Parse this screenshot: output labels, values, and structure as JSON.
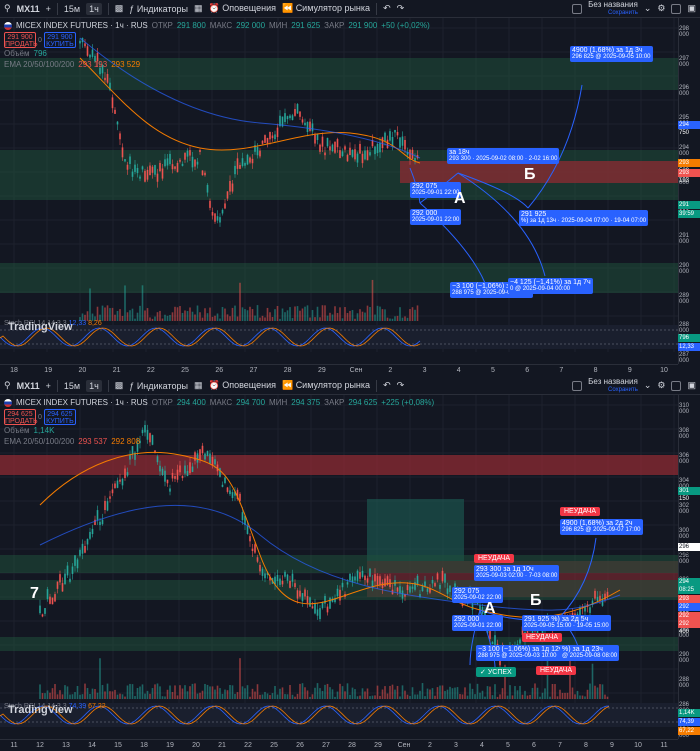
{
  "panels": [
    {
      "toolbar": {
        "symbol": "MX11",
        "interval_a": "15м",
        "interval_b": "1ч",
        "indicators": "Индикаторы",
        "alerts": "Оповещения",
        "replay": "Симулятор рынка",
        "layout_name": "Без названия",
        "layout_sub": "Сохранить"
      },
      "legend": {
        "title": "MICEX INDEX FUTURES · 1ч · RUS",
        "open_lbl": "ОТКР",
        "open": "291 800",
        "high_lbl": "МАКС",
        "high": "292 000",
        "low_lbl": "МИН",
        "low": "291 625",
        "close_lbl": "ЗАКР",
        "close": "291 900",
        "change": "+50 (+0,02%)",
        "sell_price": "291 900",
        "sell_label": "ПРОДАТЬ",
        "spread": "0",
        "buy_price": "291 900",
        "buy_label": "КУПИТЬ",
        "volume_lbl": "Объём",
        "volume": "796",
        "ema_lbl": "EMA 20/50/100/200",
        "ema1": "293 193",
        "ema2": "293 529"
      },
      "price_labels": [
        "298 000",
        "297 000",
        "296 000",
        "295 000",
        "294 000",
        "293 000",
        "292 000",
        "291 000",
        "290 000",
        "289 000",
        "288 000",
        "287 000"
      ],
      "price_tags": [
        {
          "text": "294 750",
          "color": "#2962ff"
        },
        {
          "text": "293 529",
          "color": "#f57c00"
        },
        {
          "text": "293 193",
          "color": "#ef5350"
        },
        {
          "text": "291 900",
          "color": "#089981"
        },
        {
          "text": "39:59",
          "color": "#089981"
        }
      ],
      "osc_tags": [
        {
          "text": "796",
          "color": "#089981"
        },
        {
          "text": "12,33",
          "color": "#2962ff"
        }
      ],
      "time_labels": [
        "18",
        "19",
        "20",
        "21",
        "22",
        "25",
        "26",
        "27",
        "28",
        "29",
        "Сен",
        "2",
        "3",
        "4",
        "5",
        "6",
        "7",
        "8",
        "9",
        "10"
      ],
      "osc": {
        "label": "Stoch RSI 14 14 3 3",
        "v1": "12,33",
        "v2": "8,26"
      },
      "markers": {
        "a": "А",
        "b": "Б"
      },
      "boxes": [
        {
          "main": "4900 (1,68%) за 1д 3ч",
          "sub": "296 825 @ 2025-09-05 10:00"
        },
        {
          "main": "за 18ч",
          "sub": "293 300 · 2025-09-02 08:00 · 2-02 16:00"
        },
        {
          "main": "292 075",
          "sub": "2025-09-01 22:00"
        },
        {
          "main": "292 000",
          "sub": "2025-09-01 22:00"
        },
        {
          "main": "291 925",
          "sub": "%) за 1д 13ч · 2025-09-04 07:00 · 19-04 07:00"
        },
        {
          "main": "−3 100 (−1,06%) за 20ч",
          "sub": "288 975 @ 2025-09-02 18:00"
        },
        {
          "main": "−4 125 (−1,41%) за 1д 7ч",
          "sub": "0 @ 2025-09-04 00:00"
        }
      ],
      "tv_logo": "TradingView"
    },
    {
      "toolbar": {
        "symbol": "MX11",
        "interval_a": "15м",
        "interval_b": "1ч",
        "indicators": "Индикаторы",
        "alerts": "Оповещения",
        "replay": "Симулятор рынка",
        "layout_name": "Без названия",
        "layout_sub": "Сохранить"
      },
      "legend": {
        "title": "MICEX INDEX FUTURES · 1ч · RUS",
        "open_lbl": "ОТКР",
        "open": "294 400",
        "high_lbl": "МАКС",
        "high": "294 700",
        "low_lbl": "МИН",
        "low": "294 375",
        "close_lbl": "ЗАКР",
        "close": "294 625",
        "change": "+225 (+0,08%)",
        "sell_price": "294 625",
        "sell_label": "ПРОДАТЬ",
        "spread": "0",
        "buy_price": "294 625",
        "buy_label": "КУПИТЬ",
        "volume_lbl": "Объём",
        "volume": "1,14K",
        "ema_lbl": "EMA 20/50/100/200",
        "ema1": "293 537",
        "ema2": "292 808"
      },
      "price_labels": [
        "310 000",
        "308 000",
        "306 000",
        "304 000",
        "302 000",
        "300 000",
        "298 000",
        "296 000",
        "294 000",
        "292 000",
        "290 000",
        "288 000",
        "286 000",
        "284 000"
      ],
      "price_tags": [
        {
          "text": "301 150",
          "color": "#089981"
        },
        {
          "text": "296 775",
          "color": "#ffffff"
        },
        {
          "text": "294 625",
          "color": "#089981"
        },
        {
          "text": "08:25",
          "color": "#089981"
        },
        {
          "text": "293 537",
          "color": "#ef5350"
        },
        {
          "text": "292 902",
          "color": "#2962ff"
        },
        {
          "text": "292 808",
          "color": "#ef5350"
        },
        {
          "text": "292 400",
          "color": "#ef5350"
        }
      ],
      "osc_tags": [
        {
          "text": "1,14K",
          "color": "#089981"
        },
        {
          "text": "74,39",
          "color": "#2962ff"
        },
        {
          "text": "67,22",
          "color": "#f57c00"
        }
      ],
      "time_labels": [
        "11",
        "12",
        "13",
        "14",
        "15",
        "18",
        "19",
        "20",
        "21",
        "22",
        "25",
        "26",
        "27",
        "28",
        "29",
        "Сен",
        "2",
        "3",
        "4",
        "5",
        "6",
        "7",
        "8",
        "9",
        "10",
        "11"
      ],
      "osc": {
        "label": "Stoch RSI 14 14 3 3",
        "v1": "74,39",
        "v2": "67,22"
      },
      "markers": {
        "seven": "7",
        "a": "А",
        "b": "Б"
      },
      "boxes": [
        {
          "main": "4900 (1,68%) за 2д 2ч",
          "sub": "296 825 @ 2025-09-07 17:00"
        },
        {
          "main": "293 300 за 1д 10ч",
          "sub": "2025-09-03 02:00 · 7-03 08:00"
        },
        {
          "main": "292 075",
          "sub": "2025-09-02 22:00"
        },
        {
          "main": "292 000",
          "sub": "2025-09-01 22:00"
        },
        {
          "main": "291 925 %) за 2д 5ч",
          "sub": "2025-09-05 15:00 · 19-05 15:00"
        },
        {
          "main": "−3 100 (−1,06%) за 1д 12ч",
          "sub": "288 975 @ 2025-09-03 10:00"
        },
        {
          "main": "%) за 1д 23ч",
          "sub": "@ 2025-09-08 08:00"
        }
      ],
      "badges": {
        "fail": "НЕУДАЧА",
        "ok": "УСПЕХ"
      },
      "tv_logo": "TradingView"
    }
  ]
}
